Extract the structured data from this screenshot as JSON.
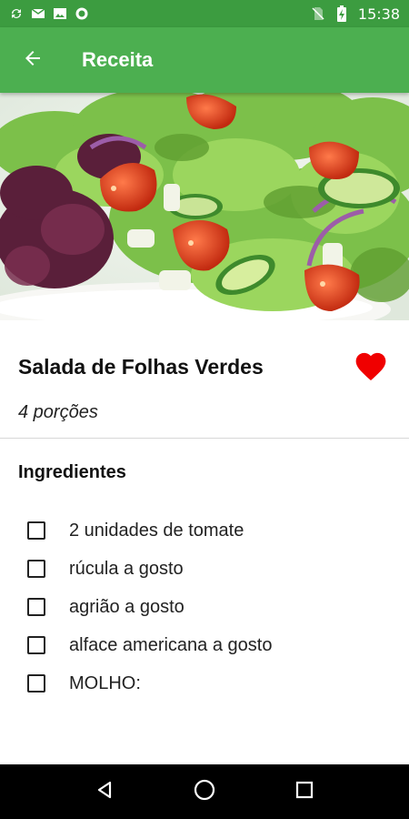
{
  "status_bar": {
    "time": "15:38",
    "icons": [
      "sync-icon",
      "mail-icon",
      "image-icon",
      "circle-icon",
      "no-sim-icon",
      "battery-charging-icon"
    ]
  },
  "app_bar": {
    "title": "Receita",
    "back_icon": "arrow-back-icon"
  },
  "recipe": {
    "title": "Salada de Folhas Verdes",
    "servings": "4 porções",
    "favorite": true,
    "favorite_color": "#f00000"
  },
  "ingredients_section": {
    "title": "Ingredientes",
    "items": [
      {
        "label": "2 unidades de tomate",
        "checked": false
      },
      {
        "label": "rúcula a gosto",
        "checked": false
      },
      {
        "label": "agrião a gosto",
        "checked": false
      },
      {
        "label": "alface americana a gosto",
        "checked": false
      },
      {
        "label": "MOLHO:",
        "checked": false
      }
    ]
  },
  "nav_bar": {
    "icons": [
      "back-triangle-icon",
      "home-circle-icon",
      "recents-square-icon"
    ]
  },
  "colors": {
    "status_bar": "#3c9c40",
    "app_bar": "#4caf50",
    "heart": "#f00000"
  }
}
